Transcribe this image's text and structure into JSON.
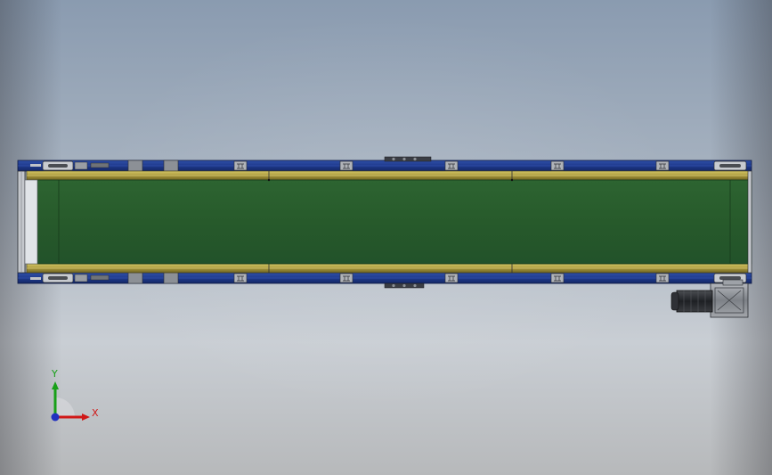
{
  "viewport": {
    "background_top": "#8a9bb0",
    "background_bottom": "#c9ced4"
  },
  "colors": {
    "belt": "#275a2b",
    "frame": "#1f3a8c",
    "side_guide": "#b8a642",
    "steel": "#8c9096",
    "motor": "#2a2c30"
  },
  "triad": {
    "x_label": "X",
    "y_label": "Y",
    "x_color": "#d01818",
    "y_color": "#18a018",
    "z_color": "#2030c0"
  }
}
